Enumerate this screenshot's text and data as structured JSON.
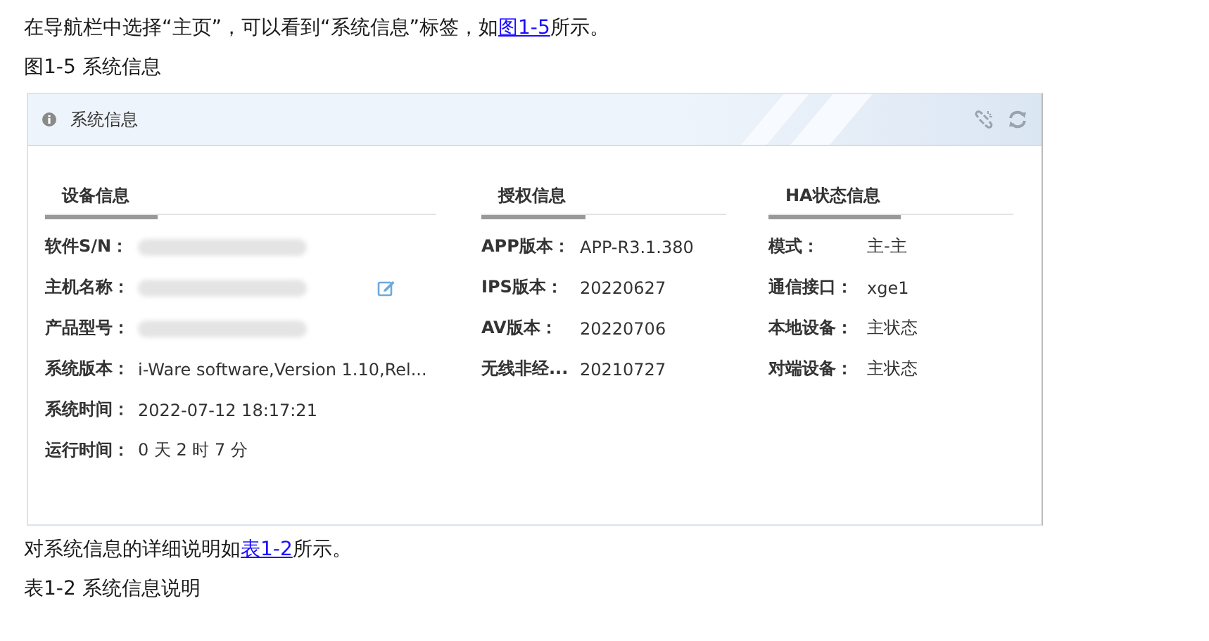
{
  "intro": {
    "before": "在导航栏中选择“主页”，可以看到“系统信息”标签，如",
    "link": "图1-5",
    "after": "所示。"
  },
  "figure_caption": "图1-5 系统信息",
  "panel": {
    "title": "系统信息",
    "sections": [
      {
        "title": "设备信息",
        "rows": [
          {
            "kind": "redacted",
            "label": "软件S/N："
          },
          {
            "kind": "redacted-editable",
            "label": "主机名称："
          },
          {
            "kind": "redacted",
            "label": "产品型号："
          },
          {
            "kind": "text",
            "label": "系统版本：",
            "value": "i-Ware software,Version 1.10,Rel..."
          },
          {
            "kind": "text",
            "label": "系统时间：",
            "value": "2022-07-12 18:17:21"
          },
          {
            "kind": "text",
            "label": "运行时间：",
            "value": "0 天 2 时 7 分"
          }
        ]
      },
      {
        "title": "授权信息",
        "rows": [
          {
            "kind": "text",
            "label": "APP版本：",
            "value": "APP-R3.1.380"
          },
          {
            "kind": "text",
            "label": "IPS版本：",
            "value": "20220627"
          },
          {
            "kind": "text",
            "label": "AV版本：",
            "value": "20220706"
          },
          {
            "kind": "text",
            "label": "无线非经...",
            "value": "20210727"
          }
        ]
      },
      {
        "title": "HA状态信息",
        "rows": [
          {
            "kind": "text",
            "label": "模式：",
            "value": "主-主"
          },
          {
            "kind": "text",
            "label": "通信接口：",
            "value": "xge1"
          },
          {
            "kind": "text",
            "label": "本地设备：",
            "value": "主状态"
          },
          {
            "kind": "text",
            "label": "对端设备：",
            "value": "主状态"
          }
        ]
      }
    ]
  },
  "outro": {
    "before": "对系统信息的详细说明如",
    "link": "表1-2",
    "after": "所示。"
  },
  "table_caption": "表1-2 系统信息说明"
}
